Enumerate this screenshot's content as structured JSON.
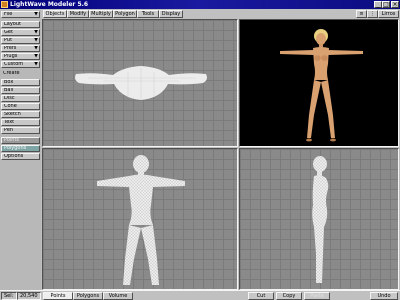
{
  "window": {
    "title": "LightWave Modeler 5.6",
    "min": "_",
    "max": "□",
    "close": "×"
  },
  "top": {
    "tabs": [
      "Objects",
      "Modify",
      "Multiply",
      "Polygon",
      "Tools",
      "Display"
    ],
    "active_tab": 0,
    "right_tools": [
      "≡",
      "⋮",
      "Lirros"
    ]
  },
  "left": {
    "file_menu": "File",
    "groups": [
      {
        "label": "Layout",
        "dropdown": false
      },
      {
        "label": "Get",
        "dropdown": true
      },
      {
        "label": "Put",
        "dropdown": true
      },
      {
        "label": "Prefs",
        "dropdown": true
      },
      {
        "label": "Plugs",
        "dropdown": true
      },
      {
        "label": "Custom",
        "dropdown": true
      }
    ],
    "create_label": "Create",
    "tools": [
      "Box",
      "Ball",
      "Disc",
      "Cone",
      "Sketch",
      "Text",
      "Pen"
    ],
    "extra": [
      "Points",
      "Polygons",
      "Options"
    ]
  },
  "status": {
    "left_label": "Sel:",
    "left_value": "20,540",
    "modes": [
      "Points",
      "Polygons",
      "Volume"
    ],
    "right_buttons": [
      "Cut",
      "Copy",
      "Paste",
      "Undo"
    ]
  },
  "colors": {
    "grid": "#8a8a8a",
    "mesh": "#e6e6e6",
    "camera_bg": "#000000",
    "skin": "#d9a070"
  },
  "icons": {
    "app": "lightwave-app-icon",
    "camera": "perspective-view"
  }
}
